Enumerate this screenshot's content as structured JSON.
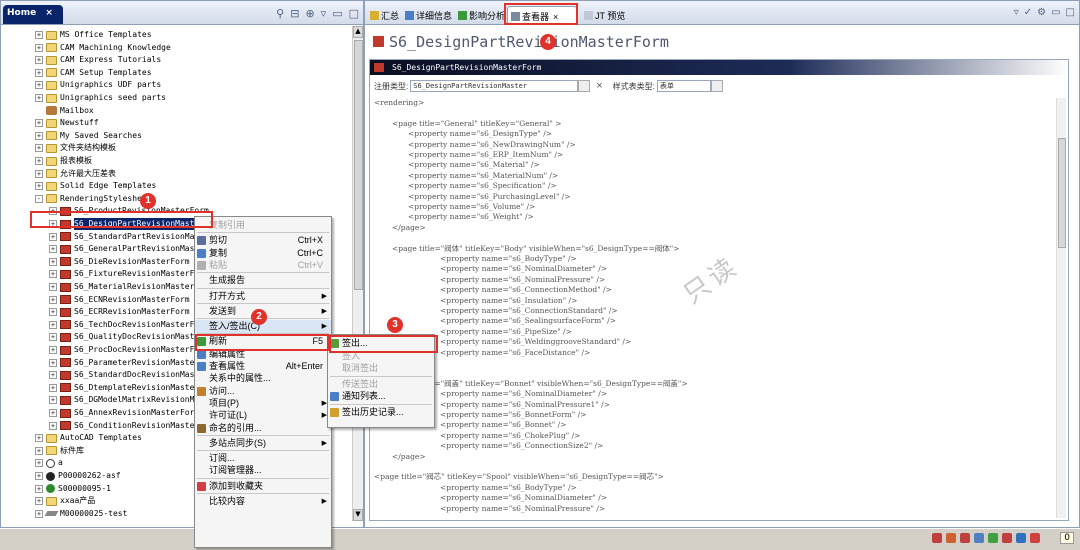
{
  "left_pane": {
    "tab_label": "Home",
    "tree": [
      {
        "exp": "+",
        "icon": "folder",
        "label": "MS Office Templates",
        "indent": 0
      },
      {
        "exp": "+",
        "icon": "folder",
        "label": "CAM Machining Knowledge",
        "indent": 0
      },
      {
        "exp": "+",
        "icon": "folder",
        "label": "CAM Express Tutorials",
        "indent": 0
      },
      {
        "exp": "+",
        "icon": "folder",
        "label": "CAM Setup Templates",
        "indent": 0
      },
      {
        "exp": "+",
        "icon": "folder",
        "label": "Unigraphics UDF parts",
        "indent": 0
      },
      {
        "exp": "+",
        "icon": "folder",
        "label": "Unigraphics seed parts",
        "indent": 0
      },
      {
        "exp": "",
        "icon": "mail",
        "label": "Mailbox",
        "indent": 0
      },
      {
        "exp": "+",
        "icon": "folder",
        "label": "Newstuff",
        "indent": 0
      },
      {
        "exp": "+",
        "icon": "folder",
        "label": "My Saved Searches",
        "indent": 0
      },
      {
        "exp": "+",
        "icon": "folder",
        "label": "文件夹结构模板",
        "indent": 0
      },
      {
        "exp": "+",
        "icon": "folder",
        "label": "报表模板",
        "indent": 0
      },
      {
        "exp": "+",
        "icon": "folder",
        "label": "允许最大压差表",
        "indent": 0
      },
      {
        "exp": "+",
        "icon": "folder",
        "label": "Solid Edge Templates",
        "indent": 0
      },
      {
        "exp": "-",
        "icon": "folder",
        "label": "RenderingStylesheet",
        "indent": 0
      },
      {
        "exp": "+",
        "icon": "form",
        "label": "S6_ProductRevisionMasterForm",
        "indent": 1
      },
      {
        "exp": "+",
        "icon": "form",
        "label": "S6_DesignPartRevisionMasterForm",
        "indent": 1,
        "selected": true
      },
      {
        "exp": "+",
        "icon": "form",
        "label": "S6_StandardPartRevisionMasterForm",
        "indent": 1
      },
      {
        "exp": "+",
        "icon": "form",
        "label": "S6_GeneralPartRevisionMasterForm",
        "indent": 1
      },
      {
        "exp": "+",
        "icon": "form",
        "label": "S6_DieRevisionMasterForm",
        "indent": 1
      },
      {
        "exp": "+",
        "icon": "form",
        "label": "S6_FixtureRevisionMasterForm",
        "indent": 1
      },
      {
        "exp": "+",
        "icon": "form",
        "label": "S6_MaterialRevisionMasterForm",
        "indent": 1
      },
      {
        "exp": "+",
        "icon": "form",
        "label": "S6_ECNRevisionMasterForm",
        "indent": 1
      },
      {
        "exp": "+",
        "icon": "form",
        "label": "S6_ECRRevisionMasterForm",
        "indent": 1
      },
      {
        "exp": "+",
        "icon": "form",
        "label": "S6_TechDocRevisionMasterForm",
        "indent": 1
      },
      {
        "exp": "+",
        "icon": "form",
        "label": "S6_QualityDocRevisionMasterForm",
        "indent": 1
      },
      {
        "exp": "+",
        "icon": "form",
        "label": "S6_ProcDocRevisionMasterForm",
        "indent": 1
      },
      {
        "exp": "+",
        "icon": "form",
        "label": "S6_ParameterRevisionMasterForm",
        "indent": 1
      },
      {
        "exp": "+",
        "icon": "form",
        "label": "S6_StandardDocRevisionMasterForm",
        "indent": 1
      },
      {
        "exp": "+",
        "icon": "form",
        "label": "S6_DtemplateRevisionMasterForm",
        "indent": 1
      },
      {
        "exp": "+",
        "icon": "form",
        "label": "S6_DGModelMatrixRevisionMasterForm",
        "indent": 1
      },
      {
        "exp": "+",
        "icon": "form",
        "label": "S6_AnnexRevisionMasterForm",
        "indent": 1
      },
      {
        "exp": "+",
        "icon": "form",
        "label": "S6_ConditionRevisionMasterForm",
        "indent": 1
      },
      {
        "exp": "+",
        "icon": "folder",
        "label": "AutoCAD Templates",
        "indent": 0
      },
      {
        "exp": "+",
        "icon": "folder",
        "label": "标件库",
        "indent": 0
      },
      {
        "exp": "+",
        "icon": "clock",
        "label": "a",
        "indent": 0
      },
      {
        "exp": "+",
        "icon": "ball",
        "label": "P00000262-asf",
        "indent": 0
      },
      {
        "exp": "+",
        "icon": "ballgreen",
        "label": "S00000095-1",
        "indent": 0
      },
      {
        "exp": "+",
        "icon": "folder",
        "label": "xxaa产品",
        "indent": 0
      },
      {
        "exp": "+",
        "icon": "pen",
        "label": "M00000025-test",
        "indent": 0
      }
    ]
  },
  "context_menu": {
    "items": [
      {
        "label": "复制引用",
        "disabled": true,
        "icon": "",
        "shortcut": ""
      },
      {
        "sep": true
      },
      {
        "label": "剪切",
        "icon": "scissors",
        "shortcut": "Ctrl+X"
      },
      {
        "label": "复制",
        "icon": "copy",
        "shortcut": "Ctrl+C"
      },
      {
        "label": "粘贴",
        "icon": "paste",
        "shortcut": "Ctrl+V",
        "disabled": true
      },
      {
        "sep": true
      },
      {
        "label": "生成报告",
        "icon": ""
      },
      {
        "sep": true
      },
      {
        "label": "打开方式",
        "icon": "",
        "sub": true
      },
      {
        "sep": true
      },
      {
        "label": "发送到",
        "icon": "",
        "sub": true
      },
      {
        "sep": true
      },
      {
        "label": "签入/签出(C)",
        "icon": "",
        "sub": true,
        "hilite": true
      },
      {
        "sep": true
      },
      {
        "label": "刷新",
        "icon": "refresh",
        "shortcut": "F5"
      },
      {
        "label": "编辑属性",
        "icon": "edit"
      },
      {
        "label": "查看属性",
        "icon": "view",
        "shortcut": "Alt+Enter"
      },
      {
        "label": "关系中的属性...",
        "icon": ""
      },
      {
        "label": "访问...",
        "icon": "access"
      },
      {
        "label": "项目(P)",
        "icon": "",
        "sub": true
      },
      {
        "label": "许可证(L)",
        "icon": "",
        "sub": true
      },
      {
        "label": "命名的引用...",
        "icon": "ref"
      },
      {
        "sep": true
      },
      {
        "label": "多站点同步(S)",
        "icon": "",
        "sub": true
      },
      {
        "sep": true
      },
      {
        "label": "订阅...",
        "icon": ""
      },
      {
        "label": "订阅管理器...",
        "icon": ""
      },
      {
        "sep": true
      },
      {
        "label": "添加到收藏夹",
        "icon": "fav"
      },
      {
        "sep": true
      },
      {
        "label": "比较内容",
        "icon": "",
        "sub": true
      }
    ]
  },
  "sub_menu": {
    "items": [
      {
        "label": "签出...",
        "icon": "checkout"
      },
      {
        "label": "签入",
        "icon": "",
        "disabled": true
      },
      {
        "label": "取消签出",
        "icon": "",
        "disabled": true
      },
      {
        "sep": true
      },
      {
        "label": "传送签出",
        "icon": "",
        "disabled": true
      },
      {
        "label": "通知列表...",
        "icon": "notify"
      },
      {
        "sep": true
      },
      {
        "label": "签出历史记录...",
        "icon": "history"
      }
    ]
  },
  "right_pane": {
    "tabs": [
      {
        "label": "汇总",
        "icon": "summary"
      },
      {
        "label": "详细信息",
        "icon": "details"
      },
      {
        "label": "影响分析",
        "icon": "impact"
      },
      {
        "label": "查看器",
        "icon": "viewer",
        "active": true,
        "close": "×"
      },
      {
        "label": "JT 预览",
        "icon": "jt"
      }
    ],
    "form_title": "S6_DesignPartRevisionMasterForm",
    "editor_header": "S6_DesignPartRevisionMasterForm",
    "type_label": "注册类型:",
    "type_value": "S6_DesignPartRevisionMaster",
    "style_label": "样式表类型:",
    "style_value": "表单",
    "clear_glyph": "×",
    "watermark": "只读",
    "code_lines": [
      {
        "t": "<rendering>",
        "i": 0
      },
      {
        "t": "",
        "i": 0
      },
      {
        "t": "<page title=\"General\" titleKey=\"General\" >",
        "i": 1
      },
      {
        "t": "<property name=\"s6_DesignType\" />",
        "i": 2
      },
      {
        "t": "<property name=\"s6_NewDrawingNum\" />",
        "i": 2
      },
      {
        "t": "<property name=\"s6_ERP_ItemNum\" />",
        "i": 2
      },
      {
        "t": "<property name=\"s6_Material\" />",
        "i": 2
      },
      {
        "t": "<property name=\"s6_MaterialNum\" />",
        "i": 2
      },
      {
        "t": "<property name=\"s6_Specification\" />",
        "i": 2
      },
      {
        "t": "<property name=\"s6_PurchasingLevel\" />",
        "i": 2
      },
      {
        "t": "<property name=\"s6_Volume\" />",
        "i": 2
      },
      {
        "t": "<property name=\"s6_Weight\" />",
        "i": 2
      },
      {
        "t": "</page>",
        "i": 1
      },
      {
        "t": "",
        "i": 0
      },
      {
        "t": "<page title=\"阀体\" titleKey=\"Body\" visibleWhen=\"s6_DesignType==阀体\">",
        "i": 1
      },
      {
        "t": "<property name=\"s6_BodyType\" />",
        "i": 3
      },
      {
        "t": "<property name=\"s6_NominalDiameter\" />",
        "i": 3
      },
      {
        "t": "<property name=\"s6_NominalPressure\" />",
        "i": 3
      },
      {
        "t": "<property name=\"s6_ConnectionMethod\" />",
        "i": 3
      },
      {
        "t": "<property name=\"s6_Insulation\" />",
        "i": 3
      },
      {
        "t": "<property name=\"s6_ConnectionStandard\" />",
        "i": 3
      },
      {
        "t": "<property name=\"s6_SealingsurfaceForm\" />",
        "i": 3
      },
      {
        "t": "<property name=\"s6_PipeSize\" />",
        "i": 3
      },
      {
        "t": "<property name=\"s6_WeldinggrooveStandard\" />",
        "i": 3
      },
      {
        "t": "<property name=\"s6_FaceDistance\" />",
        "i": 3
      },
      {
        "t": "</page>",
        "i": 1
      },
      {
        "t": "",
        "i": 0
      },
      {
        "t": "<page title=\"阀盖\" titleKey=\"Bonnet\" visibleWhen=\"s6_DesignType==阀盖\">",
        "i": 1
      },
      {
        "t": "<property name=\"s6_NominalDiameter\" />",
        "i": 3
      },
      {
        "t": "<property name=\"s6_NominalPressure1\" />",
        "i": 3
      },
      {
        "t": "<property name=\"s6_BonnetForm\" />",
        "i": 3
      },
      {
        "t": "<property name=\"s6_Bonnet\" />",
        "i": 3
      },
      {
        "t": "<property name=\"s6_ChokePlug\" />",
        "i": 3
      },
      {
        "t": "<property name=\"s6_ConnectionSize2\" />",
        "i": 3
      },
      {
        "t": "</page>",
        "i": 1
      },
      {
        "t": "",
        "i": 0
      },
      {
        "t": "<page title=\"阀芯\" titleKey=\"Spool\" visibleWhen=\"s6_DesignType==阀芯\">",
        "i": 0
      },
      {
        "t": "<property name=\"s6_BodyType\" />",
        "i": 3
      },
      {
        "t": "<property name=\"s6_NominalDiameter\" />",
        "i": 3
      },
      {
        "t": "<property name=\"s6_NominalPressure\" />",
        "i": 3
      }
    ]
  },
  "status": {
    "count": "0"
  },
  "annotations": [
    "1",
    "2",
    "3",
    "4"
  ],
  "colors": {
    "annotation": "#e0312a",
    "selection": "#0a246a",
    "menu_hilite": "#dbe6f4"
  }
}
